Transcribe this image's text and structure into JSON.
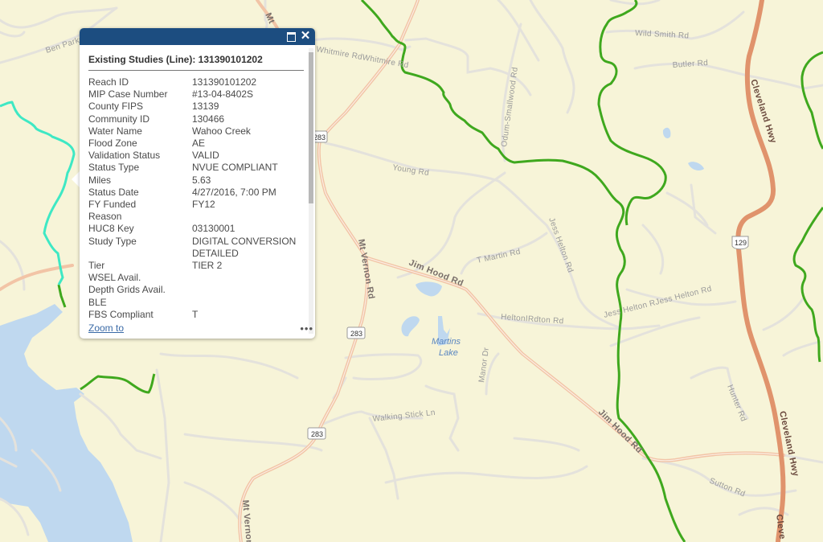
{
  "colors": {
    "land": "#f7f4d8",
    "water": "#bfd8ef",
    "minor_road": "#e4e2dc",
    "major_road": "#f2c4a6",
    "highway": "#e0936c",
    "green_boundary": "#3fa81e",
    "selected_line": "#3ee8c4",
    "popup_header": "#1c4d80"
  },
  "map": {
    "road_labels": {
      "ben_parks": "Ben Parks Rd",
      "whitmire": "Whitmire RdWhitmire Rd",
      "wild_smith": "Wild Smith Rd",
      "butler": "Butler Rd",
      "odum_smallwood": "Odum-Smallwood Rd",
      "young": "Young Rd",
      "t_martin": "T Martin Rd",
      "jess_helton": "Jess Helton Rd",
      "jess_helton_2": "Jess Helton RJess Helton Rd",
      "jim_hood_1": "Jim Hood Rd",
      "jim_hood_2": "Jim Hood Rd",
      "helton": "HeltonIRdton Rd",
      "mt_vernon_1": "Mt Vernon Rd",
      "mt_vernon_2": "Mt Vernon",
      "mt_top": "Mt",
      "manor": "Manor Dr",
      "walking_stick": "Walking Stick Ln",
      "hunter": "Hunter Rd",
      "sutton": "Sutton Rd",
      "cleveland_1": "Cleveland Hwy",
      "cleveland_2": "Cleveland Hwy",
      "cleve_3": "Cleve"
    },
    "water_labels": {
      "martins_lake_1": "Martins",
      "martins_lake_2": "Lake"
    },
    "shields": {
      "sr283_a": "283",
      "sr283_b": "283",
      "sr283_c": "283",
      "us129": "129"
    }
  },
  "popup": {
    "title": "Existing Studies (Line): 131390101202",
    "attributes": [
      {
        "key": "Reach ID",
        "value": "131390101202"
      },
      {
        "key": "MIP Case Number",
        "value": "#13-04-8402S"
      },
      {
        "key": "County FIPS",
        "value": "13139"
      },
      {
        "key": "Community ID",
        "value": "130466"
      },
      {
        "key": "Water Name",
        "value": "Wahoo Creek"
      },
      {
        "key": "Flood Zone",
        "value": "AE"
      },
      {
        "key": "Validation Status",
        "value": "VALID"
      },
      {
        "key": "Status Type",
        "value": "NVUE COMPLIANT"
      },
      {
        "key": "Miles",
        "value": "5.63"
      },
      {
        "key": "Status Date",
        "value": "4/27/2016, 7:00 PM"
      },
      {
        "key": "FY Funded",
        "value": "FY12"
      },
      {
        "key": "Reason",
        "value": ""
      },
      {
        "key": "HUC8 Key",
        "value": "03130001"
      },
      {
        "key": "Study Type",
        "value": "DIGITAL CONVERSION"
      },
      {
        "key": "",
        "value": "DETAILED"
      },
      {
        "key": "Tier",
        "value": "TIER 2"
      },
      {
        "key": "WSEL Avail.",
        "value": ""
      },
      {
        "key": "Depth Grids Avail.",
        "value": ""
      },
      {
        "key": "BLE",
        "value": ""
      },
      {
        "key": "FBS Compliant",
        "value": "T"
      }
    ],
    "zoom_to_label": "Zoom to",
    "more_label": "•••",
    "close_label": "✕",
    "maximize_icon": "maximize-icon",
    "close_icon": "close-icon"
  }
}
